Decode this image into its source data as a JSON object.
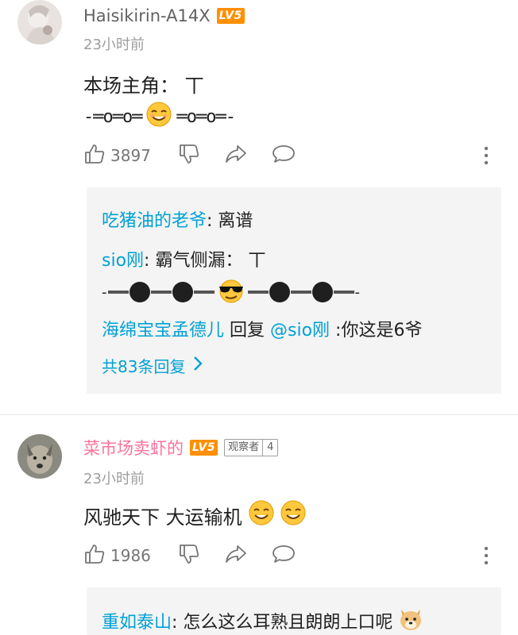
{
  "comments": [
    {
      "username": "Haisikirin-A14X",
      "level": "LV5",
      "time": "23小时前",
      "content": "本场主角：  丅",
      "deco": "-═o═o═",
      "deco_after": "═o═o═-",
      "emoji": "smiling-face-emoji",
      "likes": "3897",
      "replies": {
        "r1_name": "吃猪油的老爷",
        "r1_text": ": 离谱",
        "r2_name": "sio刚",
        "r2_text": ": 霸气侧漏：      丅",
        "r3_name": "海绵宝宝孟德儿",
        "r3_mid": " 回复 ",
        "r3_at": "@sio刚",
        "r3_text": " :你这是6爷",
        "more": "共83条回复"
      }
    },
    {
      "username": "菜市场卖虾的",
      "level": "LV5",
      "badge_text": "观察者",
      "badge_level": "4",
      "time": "23小时前",
      "content": "风驰天下 大运输机",
      "likes": "1986",
      "replies": {
        "r1_name": "重如泰山",
        "r1_text": ": 怎么这么耳熟且朗朗上口呢"
      }
    }
  ],
  "colors": {
    "link_blue": "#00a1d6",
    "vip_pink": "#fb7299",
    "level_orange": "#ff8f00",
    "reply_bg": "#f4f4f4"
  }
}
